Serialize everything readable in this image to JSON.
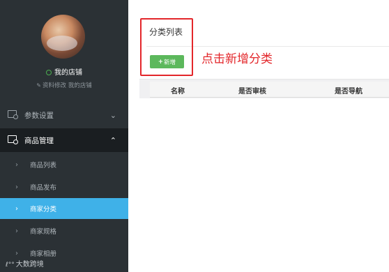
{
  "sidebar": {
    "store_name": "我的店铺",
    "edit_text": "资料修改 我的店铺",
    "menus": [
      {
        "label": "参数设置",
        "chevron": "⌄"
      },
      {
        "label": "商品管理",
        "chevron": "⌃"
      }
    ],
    "sub_items": [
      {
        "label": "商品列表"
      },
      {
        "label": "商品发布"
      },
      {
        "label": "商家分类"
      },
      {
        "label": "商家规格"
      },
      {
        "label": "商家相册"
      }
    ],
    "icons": {
      "status": "online-dot-icon",
      "edit": "pencil-icon",
      "menu": "folder-settings-icon",
      "sub": "chevron-right-icon"
    }
  },
  "main": {
    "title": "分类列表",
    "add_button": "新增",
    "annotation": "点击新增分类",
    "table_headers": [
      "名称",
      "是否审核",
      "是否导航"
    ]
  },
  "watermark": "大数跨境",
  "colors": {
    "sidebar_bg": "#2b3135",
    "active_menu_bg": "#1a1e21",
    "selected_item": "#3fb1e8",
    "add_button": "#5cb85c",
    "annotation": "#e3262a"
  }
}
